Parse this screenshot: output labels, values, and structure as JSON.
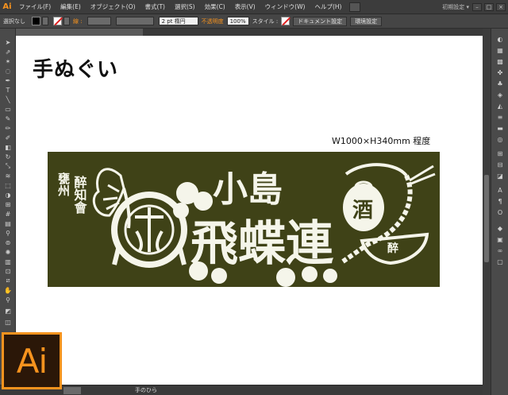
{
  "app": {
    "logo_small": "Ai",
    "logo_big": "Ai",
    "workspace": "初期設定 ▾"
  },
  "menu": [
    "ファイル(F)",
    "編集(E)",
    "オブジェクト(O)",
    "書式(T)",
    "選択(S)",
    "効果(C)",
    "表示(V)",
    "ウィンドウ(W)",
    "ヘルプ(H)"
  ],
  "control_bar": {
    "selection_label": "選択なし",
    "stroke_label": "線 :",
    "stroke_weight": "2 pt 楕円",
    "opacity_label": "不透明度",
    "opacity_value": "100%",
    "style_label": "スタイル :",
    "doc_settings": "ドキュメント設定",
    "preferences": "環境設定"
  },
  "document": {
    "tab_title": ""
  },
  "artboard": {
    "heading": "手ぬぐい",
    "size_note": "W1000×H340mm 程度"
  },
  "towel": {
    "color": "#3f4217",
    "left_text_1": "甕州",
    "left_text_2": "醉知會",
    "top_title": "小島",
    "main_title": "飛蝶連",
    "bag_mark": "醉",
    "cup_mark": "酒"
  },
  "status_bar": {
    "tool": "手のひら"
  }
}
